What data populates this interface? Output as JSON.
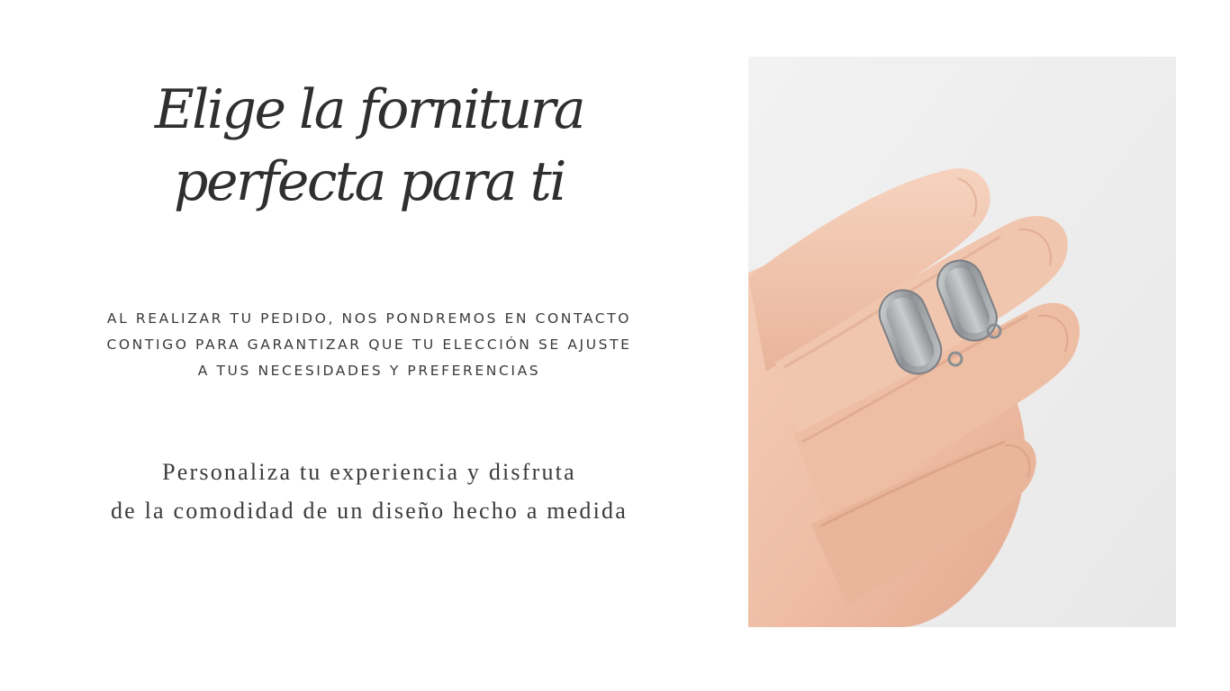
{
  "headline": {
    "line1": "Elige la fornitura",
    "line2": "perfecta para ti"
  },
  "notice": {
    "text": "AL REALIZAR TU PEDIDO, NOS PONDREMOS EN CONTACTO CONTIGO PARA GARANTIZAR QUE TU ELECCIÓN SE AJUSTE A TUS NECESIDADES Y PREFERENCIAS"
  },
  "tagline": {
    "line1": "Personaliza tu experiencia y disfruta",
    "line2": "de la comodidad de un diseño hecho a medida"
  },
  "photo": {
    "subject": "hand-holding-earring-findings-photo"
  },
  "colors": {
    "background": "#ffffff",
    "text": "#2f2f2f",
    "photo_background": "#eeeeee",
    "skin": "#f0c4ac",
    "metal": "#9fa3a6"
  }
}
